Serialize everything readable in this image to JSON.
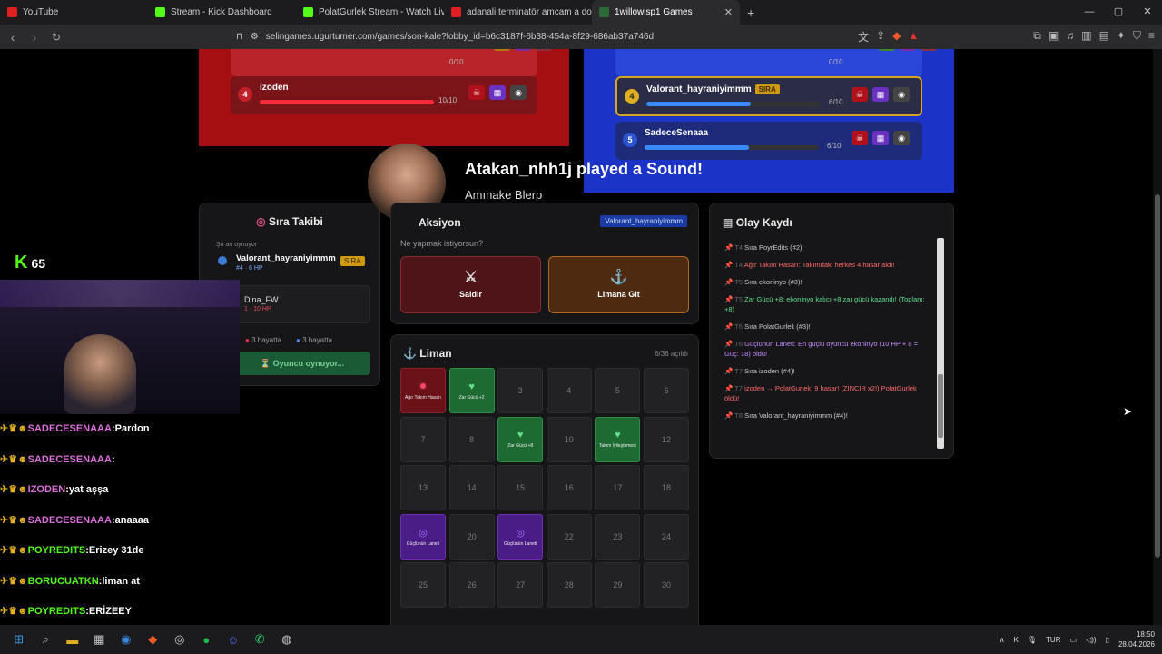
{
  "tabs": [
    {
      "label": "YouTube",
      "color": "#e02020",
      "active": false
    },
    {
      "label": "Stream - Kick Dashboard",
      "color": "#53fc18",
      "active": false
    },
    {
      "label": "PolatGurlek Stream - Watch Live on K",
      "color": "#53fc18",
      "active": false
    },
    {
      "label": "adanali terminatör amcam a dondur",
      "color": "#e02020",
      "active": false
    },
    {
      "label": "1willowisp1 Games",
      "color": "#2d6a3a",
      "active": true
    }
  ],
  "address": {
    "url": "selingames.ugurtumer.com/games/son-kale?lobby_id=b6c3187f-6b38-454a-8f29-686ab37a746d"
  },
  "red_team": {
    "rows": [
      {
        "num": "4",
        "name": "izoden",
        "hp": "10/10",
        "fill": 1.0
      }
    ],
    "top_hp": "0/10"
  },
  "blue_team": {
    "top_hp": "0/10",
    "rows": [
      {
        "num": "4",
        "name": "Valorant_hayraniyimmm",
        "badge": "SIRA",
        "hp": "6/10",
        "fill": 0.6
      },
      {
        "num": "5",
        "name": "SadeceSenaaa",
        "hp": "6/10",
        "fill": 0.6
      }
    ]
  },
  "sound_alert": {
    "title": "Atakan_nhh1j played a Sound!",
    "subtitle": "Amınake Blerp"
  },
  "kick_count": "65",
  "turn_tracker": {
    "title": "Sıra Takibi",
    "now_playing_label": "Şu an oynuyor",
    "player": "Valorant_hayraniyimmm",
    "badge": "SIRA",
    "player_meta": "#4 · 6 HP",
    "next_player": "Dina_FW",
    "next_meta": "1 · 10 HP",
    "red_alive": "3 hayatta",
    "blue_alive": "3 hayatta",
    "status_button": "Oyuncu oynuyor..."
  },
  "action": {
    "title": "Aksiyon",
    "player_tag": "Valorant_hayraniyimmm",
    "question": "Ne yapmak istiyorsun?",
    "attack": "Saldır",
    "go_port": "Limana Git"
  },
  "port": {
    "title": "Liman",
    "opened": "6/36 açıldı",
    "cells": [
      {
        "n": "",
        "type": "red",
        "label": "Ağır Takım Hasarı",
        "icon": "✸"
      },
      {
        "n": "",
        "type": "green",
        "label": "Zar Gücü +2",
        "icon": "♥"
      },
      {
        "n": "3",
        "type": ""
      },
      {
        "n": "4",
        "type": ""
      },
      {
        "n": "5",
        "type": ""
      },
      {
        "n": "6",
        "type": ""
      },
      {
        "n": "7",
        "type": ""
      },
      {
        "n": "8",
        "type": ""
      },
      {
        "n": "",
        "type": "green",
        "label": "Zar Gücü +8",
        "icon": "♥"
      },
      {
        "n": "10",
        "type": ""
      },
      {
        "n": "",
        "type": "green",
        "label": "Takım İyileştirmesi",
        "icon": "♥"
      },
      {
        "n": "12",
        "type": ""
      },
      {
        "n": "13",
        "type": ""
      },
      {
        "n": "14",
        "type": ""
      },
      {
        "n": "15",
        "type": ""
      },
      {
        "n": "16",
        "type": ""
      },
      {
        "n": "17",
        "type": ""
      },
      {
        "n": "18",
        "type": ""
      },
      {
        "n": "",
        "type": "purple",
        "label": "Güçlünün Laneti",
        "icon": "◎"
      },
      {
        "n": "20",
        "type": ""
      },
      {
        "n": "",
        "type": "purple",
        "label": "Güçlünün Laneti",
        "icon": "◎"
      },
      {
        "n": "22",
        "type": ""
      },
      {
        "n": "23",
        "type": ""
      },
      {
        "n": "24",
        "type": ""
      },
      {
        "n": "25",
        "type": ""
      },
      {
        "n": "26",
        "type": ""
      },
      {
        "n": "27",
        "type": ""
      },
      {
        "n": "28",
        "type": ""
      },
      {
        "n": "29",
        "type": ""
      },
      {
        "n": "30",
        "type": ""
      }
    ]
  },
  "event_log": {
    "title": "Olay Kaydı",
    "items": [
      {
        "t": "T4",
        "text": "Sıra  PoyrEdits (#2)!",
        "color": "#ccc"
      },
      {
        "t": "T4",
        "text": "Ağır Takım Hasarı: Takımdaki herkes 4 hasar aldı!",
        "color": "#ff6b6b"
      },
      {
        "t": "T5",
        "text": "Sıra  ekoninyo (#3)!",
        "color": "#ccc"
      },
      {
        "t": "T5",
        "text": "Zar Gücü +8: ekoninyo kalıcı +8 zar gücü kazandı! (Toplam: +8)",
        "color": "#5fe08a"
      },
      {
        "t": "T6",
        "text": "Sıra  PolatGurlek (#3)!",
        "color": "#ccc"
      },
      {
        "t": "T6",
        "text": "Güçlünün Laneti: En güçlü oyuncu ekoninyo (10 HP + 8 = Güç: 18) öldü!",
        "color": "#c58bff"
      },
      {
        "t": "T7",
        "text": "Sıra  izoden (#4)!",
        "color": "#ccc"
      },
      {
        "t": "T7",
        "text": "izoden → PolatGurlek: 9 hasar! (ZİNCİR x2!) PolatGurlek öldü!",
        "color": "#ff6b6b"
      },
      {
        "t": "T8",
        "text": "Sıra  Valorant_hayraniyimmm (#4)!",
        "color": "#ccc"
      }
    ]
  },
  "chat": [
    {
      "user": "SADECESENAAA",
      "msg": "Pardon",
      "color": "#d970d9"
    },
    {
      "user": "SADECESENAAA",
      "msg": "",
      "color": "#d970d9"
    },
    {
      "user": "IZODEN",
      "msg": "yat aşşa",
      "color": "#d970d9"
    },
    {
      "user": "SADECESENAAA",
      "msg": "anaaaa",
      "color": "#d970d9"
    },
    {
      "user": "POYREDITS",
      "msg": "Erizey 31de",
      "color": "#53fc18"
    },
    {
      "user": "BORUCUATKN",
      "msg": "liman at",
      "color": "#53fc18"
    },
    {
      "user": "POYREDITS",
      "msg": "ERİZEEY",
      "color": "#53fc18"
    }
  ],
  "taskbar": {
    "lang": "TUR",
    "time": "18:50",
    "date": "28.04.2026"
  }
}
